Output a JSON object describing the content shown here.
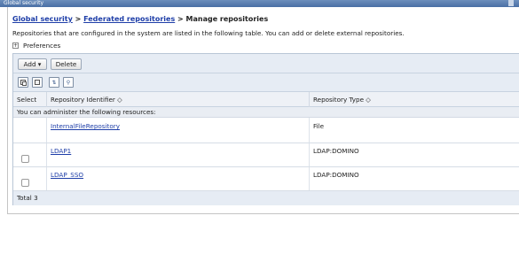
{
  "window": {
    "title": "Global security"
  },
  "breadcrumb": {
    "items": [
      "Global security",
      "Federated repositories"
    ],
    "separator": ">",
    "current": "Manage repositories"
  },
  "description": "Repositories that are configured in the system are listed in the following table. You can add or delete external repositories.",
  "preferences": {
    "expander": "+",
    "label": "Preferences"
  },
  "toolbar": {
    "add_label": "Add ▾",
    "delete_label": "Delete"
  },
  "icons": [
    "select-all-icon",
    "deselect-all-icon",
    "show-filter-icon",
    "clear-filter-icon"
  ],
  "table": {
    "columns": [
      "Select",
      "Repository Identifier ◇",
      "Repository Type ◇"
    ],
    "group_label": "You can administer the following resources:",
    "rows": [
      {
        "id": "InternalFileRepository",
        "type": "File",
        "selectable": false
      },
      {
        "id": "LDAP1",
        "type": "LDAP:DOMINO",
        "selectable": true
      },
      {
        "id": "LDAP_SSO",
        "type": "LDAP:DOMINO",
        "selectable": true
      }
    ],
    "total": "Total 3"
  },
  "colors": {
    "link": "#1e3ea8",
    "toolbar_bg": "#e6ecf4",
    "header_bg": "#eef1f6"
  }
}
